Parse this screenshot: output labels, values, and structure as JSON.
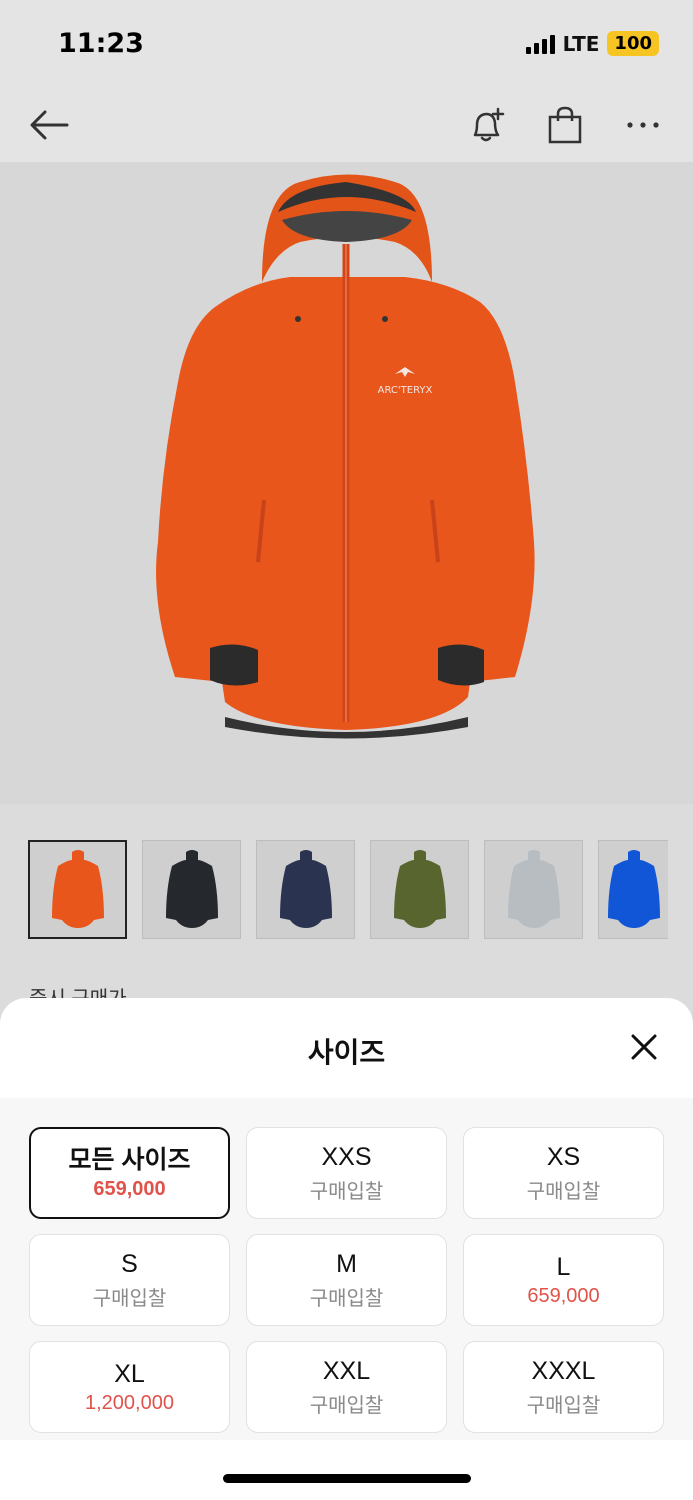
{
  "status": {
    "time": "11:23",
    "network": "LTE",
    "battery": "100"
  },
  "nav": {
    "icons": [
      "arrow-left-icon",
      "bell-plus-icon",
      "shopping-bag-icon",
      "more-icon"
    ]
  },
  "product": {
    "brand_logo_text": "ARC'TERYX",
    "thumbnail_colors": [
      "#e8561c",
      "#25282c",
      "#2a3350",
      "#58652f",
      "#b8bdc2",
      "#1256d8"
    ]
  },
  "behind_label": "즉시 구매가",
  "sheet": {
    "title": "사이즈",
    "sizes": [
      {
        "name": "모든 사이즈",
        "price": "659,000"
      },
      {
        "name": "XXS",
        "price": "구매입찰"
      },
      {
        "name": "XS",
        "price": "구매입찰"
      },
      {
        "name": "S",
        "price": "구매입찰"
      },
      {
        "name": "M",
        "price": "구매입찰"
      },
      {
        "name": "L",
        "price": "659,000"
      },
      {
        "name": "XL",
        "price": "1,200,000"
      },
      {
        "name": "XXL",
        "price": "구매입찰"
      },
      {
        "name": "XXXL",
        "price": "구매입찰"
      }
    ]
  },
  "colors": {
    "accent_red": "#e0534a",
    "jacket_orange": "#e8561c"
  }
}
